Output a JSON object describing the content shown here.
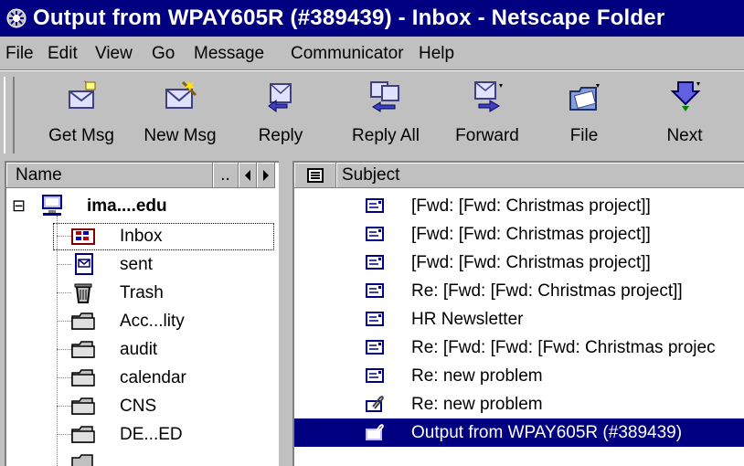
{
  "window": {
    "title": "Output from WPAY605R (#389439) - Inbox - Netscape Folder"
  },
  "menubar": {
    "items": [
      "File",
      "Edit",
      "View",
      "Go",
      "Message",
      "Communicator",
      "Help"
    ]
  },
  "toolbar": {
    "buttons": [
      {
        "label": "Get Msg",
        "icon": "get-msg-icon"
      },
      {
        "label": "New Msg",
        "icon": "new-msg-icon"
      },
      {
        "label": "Reply",
        "icon": "reply-icon"
      },
      {
        "label": "Reply All",
        "icon": "reply-all-icon"
      },
      {
        "label": "Forward",
        "icon": "forward-icon"
      },
      {
        "label": "File",
        "icon": "file-icon"
      },
      {
        "label": "Next",
        "icon": "next-icon"
      }
    ]
  },
  "folder_pane": {
    "column_header": "Name",
    "collapse_label": "..",
    "account": "ima....edu",
    "expander": "⊟",
    "folders": [
      {
        "label": "Inbox",
        "icon": "inbox-icon",
        "selected": true
      },
      {
        "label": "sent",
        "icon": "sent-icon"
      },
      {
        "label": "Trash",
        "icon": "trash-icon"
      },
      {
        "label": "Acc...lity",
        "icon": "folder-icon"
      },
      {
        "label": "audit",
        "icon": "folder-icon"
      },
      {
        "label": "calendar",
        "icon": "folder-icon"
      },
      {
        "label": "CNS",
        "icon": "folder-icon"
      },
      {
        "label": "DE...ED",
        "icon": "folder-icon"
      }
    ]
  },
  "message_pane": {
    "column_header": "Subject",
    "messages": [
      {
        "subject": "[Fwd: [Fwd: Christmas project]]",
        "icon": "message-icon"
      },
      {
        "subject": "[Fwd: [Fwd: Christmas project]]",
        "icon": "message-icon"
      },
      {
        "subject": "[Fwd: [Fwd: Christmas project]]",
        "icon": "message-icon"
      },
      {
        "subject": "Re: [Fwd: [Fwd: Christmas project]]",
        "icon": "message-icon"
      },
      {
        "subject": "HR Newsletter",
        "icon": "message-icon"
      },
      {
        "subject": "Re: [Fwd: [Fwd: [Fwd: Christmas projec",
        "icon": "message-icon"
      },
      {
        "subject": "Re: new problem",
        "icon": "message-icon"
      },
      {
        "subject": "Re: new problem",
        "icon": "attachment-message-icon"
      },
      {
        "subject": "Output from WPAY605R (#389439)",
        "icon": "attachment-message-icon",
        "selected": true
      }
    ]
  },
  "colors": {
    "titlebar": "#000080",
    "selection": "#000080",
    "chrome": "#c0c0c0"
  }
}
